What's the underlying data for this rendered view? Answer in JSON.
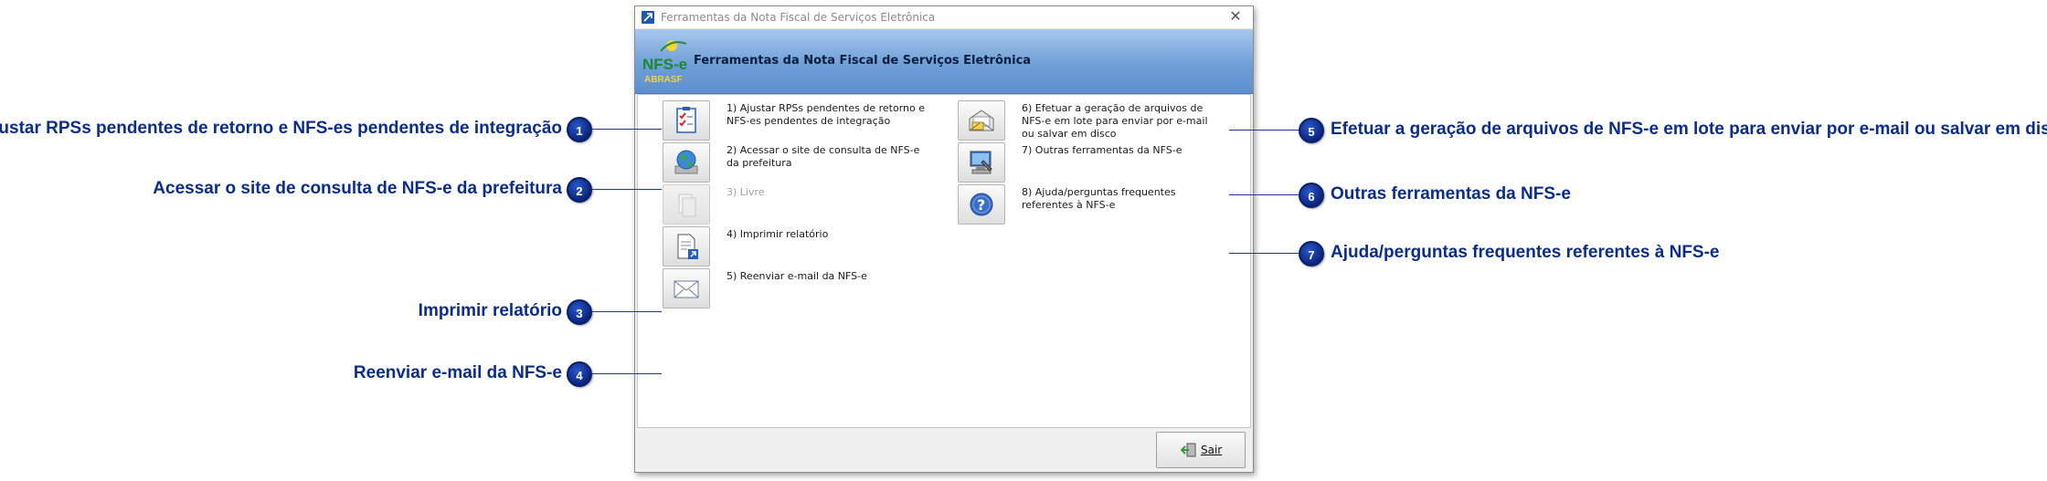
{
  "window": {
    "title": "Ferramentas da Nota Fiscal de Serviços Eletrônica",
    "close_icon": "close-icon",
    "header_title": "Ferramentas da Nota Fiscal de Serviços Eletrônica",
    "logo_text_top": "NFS-e",
    "logo_text_bottom": "ABRASF"
  },
  "tools": [
    {
      "label": "1) Ajustar RPSs pendentes de retorno e NFS-es pendentes de integração",
      "icon": "checklist-icon",
      "enabled": true
    },
    {
      "label": "2) Acessar o site de consulta de NFS-e da prefeitura",
      "icon": "globe-icon",
      "enabled": true
    },
    {
      "label": "3) Livre",
      "icon": "blank-document-icon",
      "enabled": false
    },
    {
      "label": "4) Imprimir relatório",
      "icon": "report-icon",
      "enabled": true
    },
    {
      "label": "5) Reenviar e-mail da NFS-e",
      "icon": "envelope-icon",
      "enabled": true
    },
    {
      "label": "6) Efetuar a geração de arquivos de NFS-e em lote para enviar por e-mail ou salvar em disco",
      "icon": "mail-export-icon",
      "enabled": true
    },
    {
      "label": "7) Outras ferramentas da NFS-e",
      "icon": "tools-computer-icon",
      "enabled": true
    },
    {
      "label": "8) Ajuda/perguntas frequentes referentes à NFS-e",
      "icon": "help-icon",
      "enabled": true
    }
  ],
  "footer": {
    "exit_label": "Sair",
    "exit_icon": "exit-door-icon"
  },
  "callouts": [
    {
      "number": "1",
      "text": "Ajustar RPSs pendentes de retorno e NFS-es pendentes de integração"
    },
    {
      "number": "2",
      "text": "Acessar o site de consulta de NFS-e da prefeitura"
    },
    {
      "number": "3",
      "text": "Imprimir relatório"
    },
    {
      "number": "4",
      "text": "Reenviar e-mail da NFS-e"
    },
    {
      "number": "5",
      "text": "Efetuar a geração de arquivos de NFS-e em lote para enviar por e-mail ou salvar em disco"
    },
    {
      "number": "6",
      "text": "Outras ferramentas da NFS-e"
    },
    {
      "number": "7",
      "text": "Ajuda/perguntas frequentes referentes à NFS-e"
    }
  ],
  "colors": {
    "callout_text": "#0a2d8c",
    "badge": "#0a2580",
    "header_gradient_top": "#a7c8ee",
    "header_gradient_bottom": "#5d8fd0"
  }
}
